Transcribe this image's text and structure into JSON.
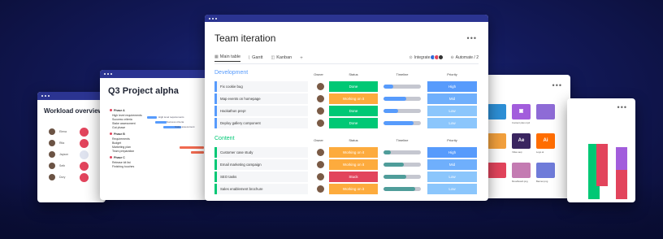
{
  "workload": {
    "title": "Workload overview",
    "people": [
      {
        "name": "Elena",
        "dot_color": "#e2445c"
      },
      {
        "name": "Rita",
        "dot_color": "#e2445c"
      },
      {
        "name": "Jayson",
        "dot_color": "#dfe3ef"
      },
      {
        "name": "Seth",
        "dot_color": "#e2445c"
      },
      {
        "name": "Dory",
        "dot_color": "#e2445c"
      }
    ]
  },
  "project": {
    "title": "Q3 Project alpha",
    "phases": [
      {
        "name": "Phase A",
        "items": [
          "High level requirements",
          "Success criteria",
          "Stake assessment",
          "Gut phase"
        ]
      },
      {
        "name": "Phase B",
        "items": [
          "Requirements",
          "Budget",
          "Marketing plan",
          "Team preparation"
        ]
      },
      {
        "name": "Phase C",
        "items": [
          "Release kit list",
          "Finishing touches"
        ]
      }
    ],
    "gantt_labels": [
      "High level requirements",
      "Success criteria",
      "Stake assessment"
    ]
  },
  "main": {
    "title": "Team iteration",
    "more": "•••",
    "tabs": [
      {
        "label": "Main table",
        "icon": "table-icon"
      },
      {
        "label": "Gantt",
        "icon": "gantt-icon"
      },
      {
        "label": "Kanban",
        "icon": "kanban-icon"
      }
    ],
    "add_tab": "+",
    "integrate": "Integrate",
    "automate": "Automate / 2",
    "columns": {
      "owner": "Owner",
      "status": "Status",
      "timeline": "Timeline",
      "priority": "Priority"
    },
    "groups": [
      {
        "title": "Development",
        "color": "#579bfc",
        "rows": [
          {
            "name": "Fix cookie bug",
            "status": "Done",
            "status_color": "#00c875",
            "timeline": 0.25,
            "priority": "High",
            "priority_color": "#579bfc"
          },
          {
            "name": "Map events on homepage",
            "status": "Working on it",
            "status_color": "#fdab3d",
            "timeline": 0.6,
            "priority": "Mid",
            "priority_color": "#6faffc"
          },
          {
            "name": "Hackathon prep!",
            "status": "Done",
            "status_color": "#00c875",
            "timeline": 0.4,
            "priority": "Low",
            "priority_color": "#8bc6fc"
          },
          {
            "name": "Deploy gallery component",
            "status": "Done",
            "status_color": "#00c875",
            "timeline": 0.8,
            "priority": "Low",
            "priority_color": "#8bc6fc"
          }
        ]
      },
      {
        "title": "Content",
        "color": "#00c875",
        "rows": [
          {
            "name": "Customer case study",
            "status": "Working on it",
            "status_color": "#fdab3d",
            "timeline": 0.2,
            "priority": "High",
            "priority_color": "#579bfc"
          },
          {
            "name": "Email marketing campaign",
            "status": "Working on it",
            "status_color": "#fdab3d",
            "timeline": 0.55,
            "priority": "Mid",
            "priority_color": "#6faffc"
          },
          {
            "name": "SEO tasks",
            "status": "Stuck",
            "status_color": "#e2445c",
            "timeline": 0.6,
            "priority": "Low",
            "priority_color": "#8bc6fc"
          },
          {
            "name": "Sales enablement brochure",
            "status": "Working on it",
            "status_color": "#fdab3d",
            "timeline": 0.85,
            "priority": "Low",
            "priority_color": "#8bc6fc"
          }
        ]
      }
    ]
  },
  "files": {
    "more": "•••",
    "tiles": [
      {
        "kind": "image",
        "color": "#2d8fd6",
        "caption": ""
      },
      {
        "kind": "icon",
        "color": "#a25ddc",
        "label": "▣",
        "caption": "Content plan.mp4"
      },
      {
        "kind": "image",
        "color": "#8e6bd6",
        "caption": ""
      },
      {
        "kind": "image",
        "color": "#f2a03d",
        "caption": ""
      },
      {
        "kind": "icon",
        "color": "#3a2560",
        "label": "Ae",
        "caption": "Video.aep"
      },
      {
        "kind": "icon",
        "color": "#ff6d00",
        "label": "Ai",
        "caption": "Logo.ai"
      },
      {
        "kind": "image",
        "color": "#e2445c",
        "caption": ""
      },
      {
        "kind": "image",
        "color": "#c47bb2",
        "caption": "Moodboard.png"
      },
      {
        "kind": "image",
        "color": "#6f7bd9",
        "caption": "Banner.png"
      }
    ]
  },
  "chart": {
    "more": "•••"
  }
}
